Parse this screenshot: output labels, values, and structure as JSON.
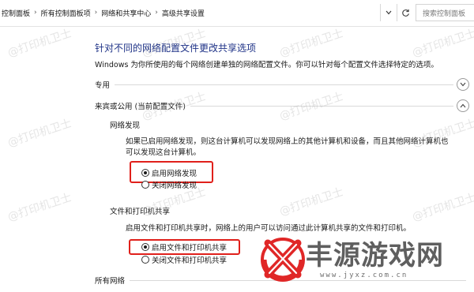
{
  "breadcrumbs": [
    "控制面板",
    "所有控制面板项",
    "网络和共享中心",
    "高级共享设置"
  ],
  "search": {
    "placeholder": "搜索控制面板"
  },
  "page": {
    "title": "针对不同的网络配置文件更改共享选项",
    "description": "Windows 为你所使用的每个网络创建单独的网络配置文件。你可以针对每个配置文件选择特定的选项。"
  },
  "sections": {
    "private": {
      "label": "专用"
    },
    "guest": {
      "label": "来宾或公用 (当前配置文件)"
    },
    "all": {
      "label": "所有网络"
    }
  },
  "network_discovery": {
    "label": "网络发现",
    "description_line1": "如果已启用网络发现，则这台计算机可以发现网络上的其他计算机和设备，而且其他网络计算机也",
    "description_line2": "可以发现这台计算机。",
    "options": [
      "启用网络发现",
      "关闭网络发现"
    ],
    "selected": "启用网络发现"
  },
  "file_printer_sharing": {
    "label": "文件和打印机共享",
    "description": "启用文件和打印机共享时，网络上的用户可以访问通过此计算机共享的文件和打印机。",
    "options": [
      "启用文件和打印机共享",
      "关闭文件和打印机共享"
    ],
    "selected": "启用文件和打印机共享"
  },
  "watermark": {
    "text": "@打印机卫士"
  },
  "logo": {
    "text": "丰源游戏网",
    "url": "www.jyxz.com.cn"
  },
  "colors": {
    "title": "#1e3287",
    "highlight": "#e0201b",
    "logo_red": "#e02727"
  }
}
